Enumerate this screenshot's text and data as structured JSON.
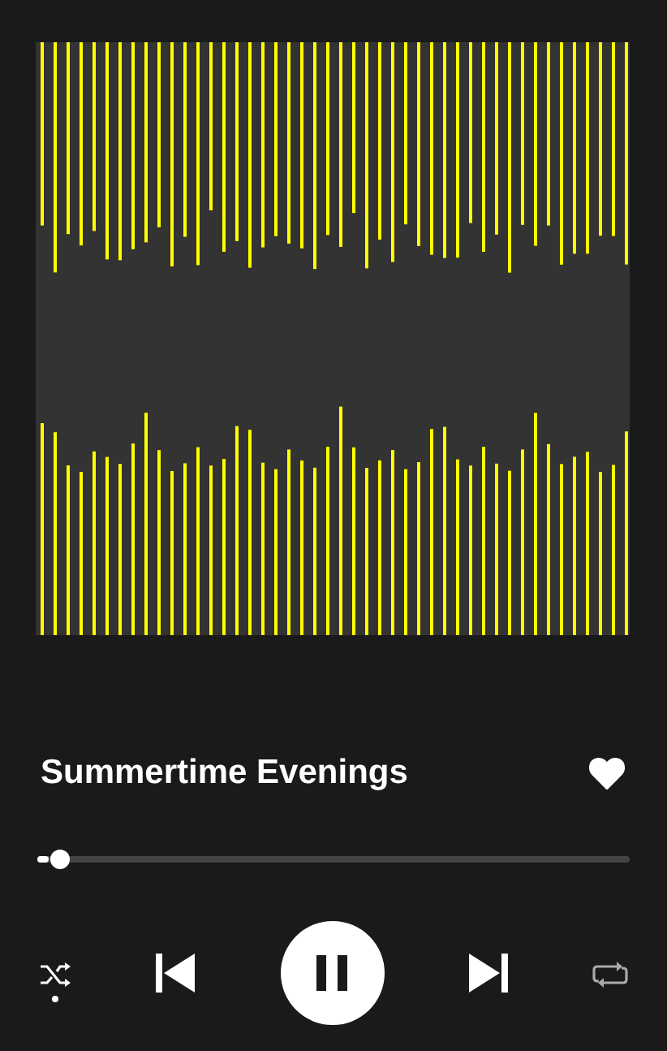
{
  "track": {
    "title": "Summertime Evenings",
    "liked": true
  },
  "progress": {
    "level": 0.02
  },
  "controls": {
    "shuffle": true,
    "playing": true,
    "repeat": false
  }
}
